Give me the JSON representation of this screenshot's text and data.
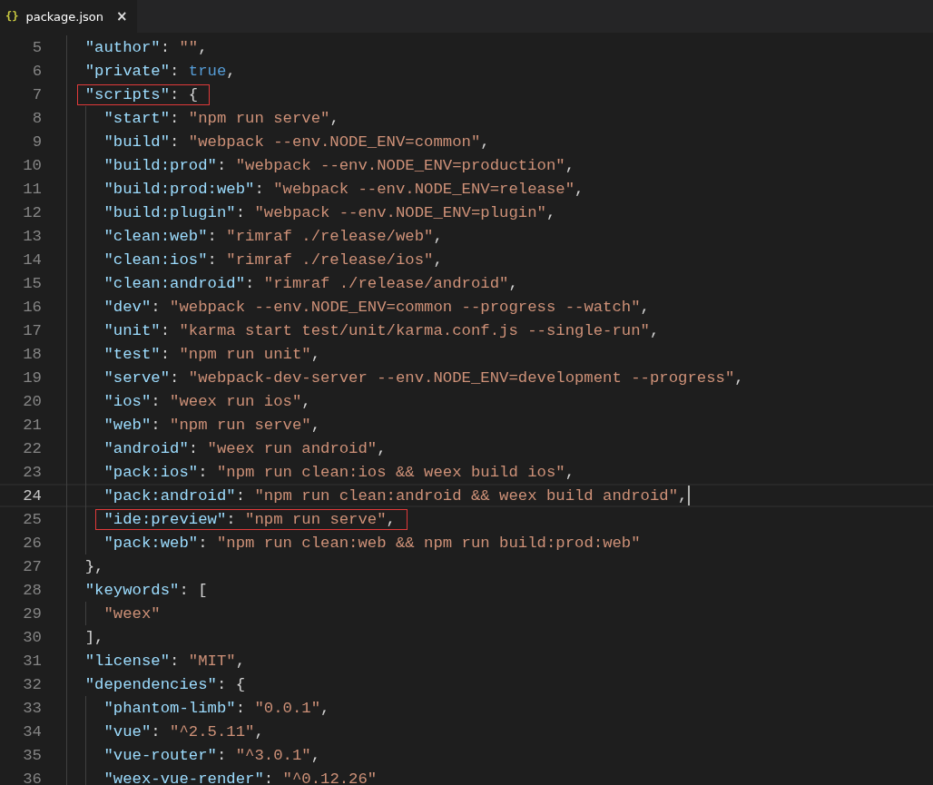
{
  "tab": {
    "icon": "{}",
    "label": "package.json",
    "close": "×",
    "selected": true
  },
  "editor": {
    "lines": [
      {
        "number": "5",
        "current": false,
        "boxed": false,
        "tokens": [
          {
            "kind": "key",
            "text": "\"author\""
          },
          {
            "kind": "punct",
            "text": ": "
          },
          {
            "kind": "string",
            "text": "\"\""
          },
          {
            "kind": "punct",
            "text": ","
          }
        ]
      },
      {
        "number": "6",
        "current": false,
        "boxed": false,
        "tokens": [
          {
            "kind": "key",
            "text": "\"private\""
          },
          {
            "kind": "punct",
            "text": ": "
          },
          {
            "kind": "keyword",
            "text": "true"
          },
          {
            "kind": "punct",
            "text": ","
          }
        ]
      },
      {
        "number": "7",
        "current": false,
        "boxed": true,
        "tokens": [
          {
            "kind": "key",
            "text": "\"scripts\""
          },
          {
            "kind": "punct",
            "text": ": {"
          }
        ],
        "children": [
          {
            "number": "8",
            "current": false,
            "boxed": false,
            "tokens": [
              {
                "kind": "key",
                "text": "\"start\""
              },
              {
                "kind": "punct",
                "text": ": "
              },
              {
                "kind": "string",
                "text": "\"npm run serve\""
              },
              {
                "kind": "punct",
                "text": ","
              }
            ]
          },
          {
            "number": "9",
            "current": false,
            "boxed": false,
            "tokens": [
              {
                "kind": "key",
                "text": "\"build\""
              },
              {
                "kind": "punct",
                "text": ": "
              },
              {
                "kind": "string",
                "text": "\"webpack --env.NODE_ENV=common\""
              },
              {
                "kind": "punct",
                "text": ","
              }
            ]
          },
          {
            "number": "10",
            "current": false,
            "boxed": false,
            "tokens": [
              {
                "kind": "key",
                "text": "\"build:prod\""
              },
              {
                "kind": "punct",
                "text": ": "
              },
              {
                "kind": "string",
                "text": "\"webpack --env.NODE_ENV=production\""
              },
              {
                "kind": "punct",
                "text": ","
              }
            ]
          },
          {
            "number": "11",
            "current": false,
            "boxed": false,
            "tokens": [
              {
                "kind": "key",
                "text": "\"build:prod:web\""
              },
              {
                "kind": "punct",
                "text": ": "
              },
              {
                "kind": "string",
                "text": "\"webpack --env.NODE_ENV=release\""
              },
              {
                "kind": "punct",
                "text": ","
              }
            ]
          },
          {
            "number": "12",
            "current": false,
            "boxed": false,
            "tokens": [
              {
                "kind": "key",
                "text": "\"build:plugin\""
              },
              {
                "kind": "punct",
                "text": ": "
              },
              {
                "kind": "string",
                "text": "\"webpack --env.NODE_ENV=plugin\""
              },
              {
                "kind": "punct",
                "text": ","
              }
            ]
          },
          {
            "number": "13",
            "current": false,
            "boxed": false,
            "tokens": [
              {
                "kind": "key",
                "text": "\"clean:web\""
              },
              {
                "kind": "punct",
                "text": ": "
              },
              {
                "kind": "string",
                "text": "\"rimraf ./release/web\""
              },
              {
                "kind": "punct",
                "text": ","
              }
            ]
          },
          {
            "number": "14",
            "current": false,
            "boxed": false,
            "tokens": [
              {
                "kind": "key",
                "text": "\"clean:ios\""
              },
              {
                "kind": "punct",
                "text": ": "
              },
              {
                "kind": "string",
                "text": "\"rimraf ./release/ios\""
              },
              {
                "kind": "punct",
                "text": ","
              }
            ]
          },
          {
            "number": "15",
            "current": false,
            "boxed": false,
            "tokens": [
              {
                "kind": "key",
                "text": "\"clean:android\""
              },
              {
                "kind": "punct",
                "text": ": "
              },
              {
                "kind": "string",
                "text": "\"rimraf ./release/android\""
              },
              {
                "kind": "punct",
                "text": ","
              }
            ]
          },
          {
            "number": "16",
            "current": false,
            "boxed": false,
            "tokens": [
              {
                "kind": "key",
                "text": "\"dev\""
              },
              {
                "kind": "punct",
                "text": ": "
              },
              {
                "kind": "string",
                "text": "\"webpack --env.NODE_ENV=common --progress --watch\""
              },
              {
                "kind": "punct",
                "text": ","
              }
            ]
          },
          {
            "number": "17",
            "current": false,
            "boxed": false,
            "tokens": [
              {
                "kind": "key",
                "text": "\"unit\""
              },
              {
                "kind": "punct",
                "text": ": "
              },
              {
                "kind": "string",
                "text": "\"karma start test/unit/karma.conf.js --single-run\""
              },
              {
                "kind": "punct",
                "text": ","
              }
            ]
          },
          {
            "number": "18",
            "current": false,
            "boxed": false,
            "tokens": [
              {
                "kind": "key",
                "text": "\"test\""
              },
              {
                "kind": "punct",
                "text": ": "
              },
              {
                "kind": "string",
                "text": "\"npm run unit\""
              },
              {
                "kind": "punct",
                "text": ","
              }
            ]
          },
          {
            "number": "19",
            "current": false,
            "boxed": false,
            "tokens": [
              {
                "kind": "key",
                "text": "\"serve\""
              },
              {
                "kind": "punct",
                "text": ": "
              },
              {
                "kind": "string",
                "text": "\"webpack-dev-server --env.NODE_ENV=development --progress\""
              },
              {
                "kind": "punct",
                "text": ","
              }
            ]
          },
          {
            "number": "20",
            "current": false,
            "boxed": false,
            "tokens": [
              {
                "kind": "key",
                "text": "\"ios\""
              },
              {
                "kind": "punct",
                "text": ": "
              },
              {
                "kind": "string",
                "text": "\"weex run ios\""
              },
              {
                "kind": "punct",
                "text": ","
              }
            ]
          },
          {
            "number": "21",
            "current": false,
            "boxed": false,
            "tokens": [
              {
                "kind": "key",
                "text": "\"web\""
              },
              {
                "kind": "punct",
                "text": ": "
              },
              {
                "kind": "string",
                "text": "\"npm run serve\""
              },
              {
                "kind": "punct",
                "text": ","
              }
            ]
          },
          {
            "number": "22",
            "current": false,
            "boxed": false,
            "tokens": [
              {
                "kind": "key",
                "text": "\"android\""
              },
              {
                "kind": "punct",
                "text": ": "
              },
              {
                "kind": "string",
                "text": "\"weex run android\""
              },
              {
                "kind": "punct",
                "text": ","
              }
            ]
          },
          {
            "number": "23",
            "current": false,
            "boxed": false,
            "tokens": [
              {
                "kind": "key",
                "text": "\"pack:ios\""
              },
              {
                "kind": "punct",
                "text": ": "
              },
              {
                "kind": "string",
                "text": "\"npm run clean:ios && weex build ios\""
              },
              {
                "kind": "punct",
                "text": ","
              }
            ]
          },
          {
            "number": "24",
            "current": true,
            "boxed": false,
            "tokens": [
              {
                "kind": "key",
                "text": "\"pack:android\""
              },
              {
                "kind": "punct",
                "text": ": "
              },
              {
                "kind": "string",
                "text": "\"npm run clean:android && weex build android\""
              },
              {
                "kind": "punct",
                "text": ","
              }
            ]
          },
          {
            "number": "25",
            "current": false,
            "boxed": true,
            "tokens": [
              {
                "kind": "key",
                "text": "\"ide:preview\""
              },
              {
                "kind": "punct",
                "text": ": "
              },
              {
                "kind": "string",
                "text": "\"npm run serve\""
              },
              {
                "kind": "punct",
                "text": ","
              }
            ]
          },
          {
            "number": "26",
            "current": false,
            "boxed": false,
            "tokens": [
              {
                "kind": "key",
                "text": "\"pack:web\""
              },
              {
                "kind": "punct",
                "text": ": "
              },
              {
                "kind": "string",
                "text": "\"npm run clean:web && npm run build:prod:web\""
              }
            ]
          }
        ]
      },
      {
        "number": "27",
        "current": false,
        "boxed": false,
        "tokens": [
          {
            "kind": "punct",
            "text": "},"
          }
        ]
      },
      {
        "number": "28",
        "current": false,
        "boxed": false,
        "tokens": [
          {
            "kind": "key",
            "text": "\"keywords\""
          },
          {
            "kind": "punct",
            "text": ": ["
          }
        ],
        "children": [
          {
            "number": "29",
            "current": false,
            "boxed": false,
            "tokens": [
              {
                "kind": "string",
                "text": "\"weex\""
              }
            ]
          }
        ]
      },
      {
        "number": "30",
        "current": false,
        "boxed": false,
        "tokens": [
          {
            "kind": "punct",
            "text": "],"
          }
        ]
      },
      {
        "number": "31",
        "current": false,
        "boxed": false,
        "tokens": [
          {
            "kind": "key",
            "text": "\"license\""
          },
          {
            "kind": "punct",
            "text": ": "
          },
          {
            "kind": "string",
            "text": "\"MIT\""
          },
          {
            "kind": "punct",
            "text": ","
          }
        ]
      },
      {
        "number": "32",
        "current": false,
        "boxed": false,
        "tokens": [
          {
            "kind": "key",
            "text": "\"dependencies\""
          },
          {
            "kind": "punct",
            "text": ": {"
          }
        ],
        "children": [
          {
            "number": "33",
            "current": false,
            "boxed": false,
            "tokens": [
              {
                "kind": "key",
                "text": "\"phantom-limb\""
              },
              {
                "kind": "punct",
                "text": ": "
              },
              {
                "kind": "string",
                "text": "\"0.0.1\""
              },
              {
                "kind": "punct",
                "text": ","
              }
            ]
          },
          {
            "number": "34",
            "current": false,
            "boxed": false,
            "tokens": [
              {
                "kind": "key",
                "text": "\"vue\""
              },
              {
                "kind": "punct",
                "text": ": "
              },
              {
                "kind": "string",
                "text": "\"^2.5.11\""
              },
              {
                "kind": "punct",
                "text": ","
              }
            ]
          },
          {
            "number": "35",
            "current": false,
            "boxed": false,
            "tokens": [
              {
                "kind": "key",
                "text": "\"vue-router\""
              },
              {
                "kind": "punct",
                "text": ": "
              },
              {
                "kind": "string",
                "text": "\"^3.0.1\""
              },
              {
                "kind": "punct",
                "text": ","
              }
            ]
          },
          {
            "number": "36",
            "current": false,
            "boxed": false,
            "tokens": [
              {
                "kind": "key",
                "text": "\"weex-vue-render\""
              },
              {
                "kind": "punct",
                "text": ": "
              },
              {
                "kind": "string",
                "text": "\"^0.12.26\""
              }
            ]
          }
        ]
      }
    ]
  }
}
